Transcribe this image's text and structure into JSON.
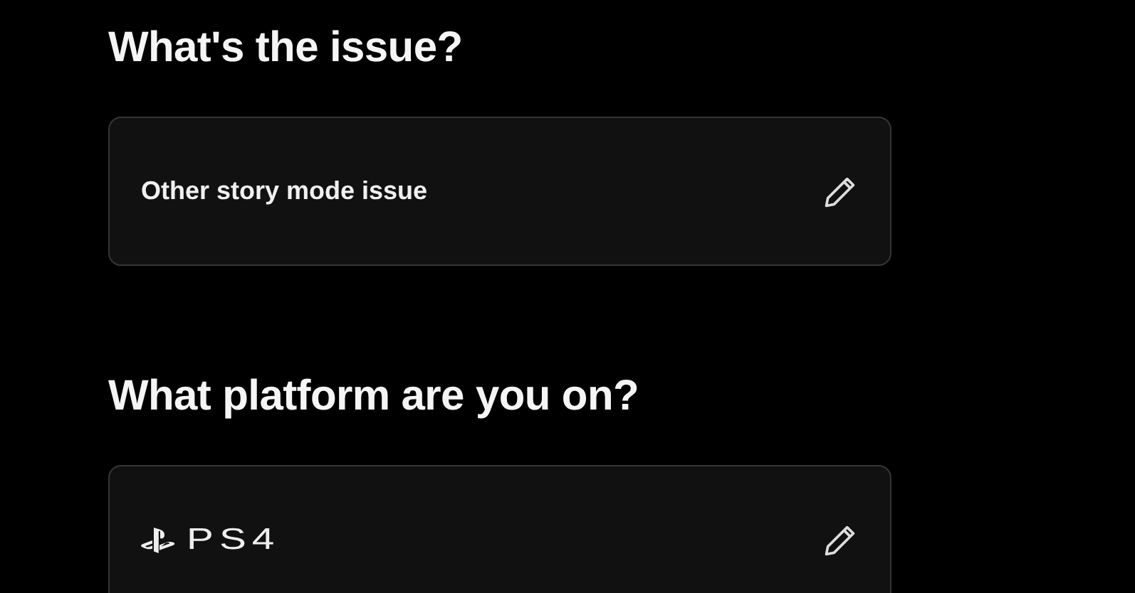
{
  "sections": [
    {
      "question": "What's the issue?",
      "answer": {
        "kind": "text",
        "text": "Other story mode issue"
      }
    },
    {
      "question": "What platform are you on?",
      "answer": {
        "kind": "platform",
        "text": "PS4"
      }
    }
  ]
}
